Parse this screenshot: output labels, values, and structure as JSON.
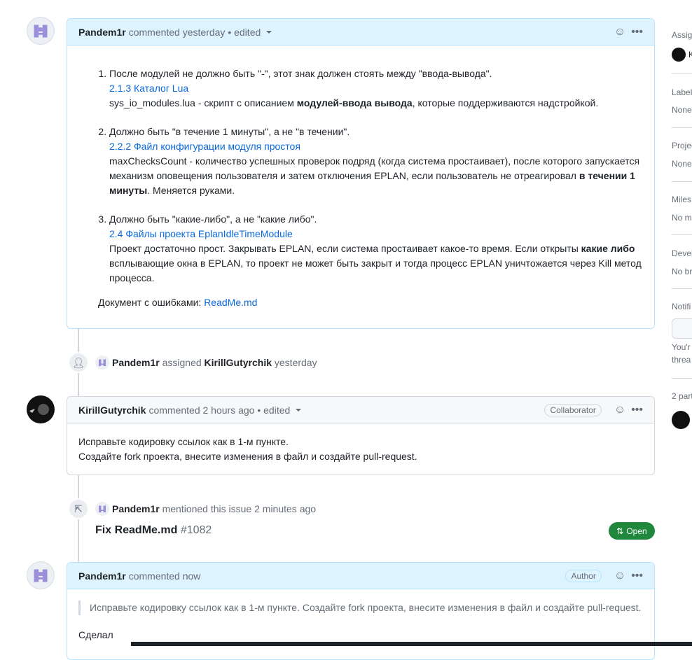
{
  "comments": [
    {
      "author": "Pandem1r",
      "action": "commented yesterday",
      "edited": "• edited",
      "items": [
        {
          "text": "После модулей не должно быть \"-\", этот знак должен стоять между \"ввода-вывода\".",
          "link": "2.1.3 Каталог Lua",
          "desc_pre": "sys_io_modules.lua - скрипт с описанием ",
          "desc_bold": "модулей-ввода вывода",
          "desc_post": ", которые поддерживаются надстройкой."
        },
        {
          "text": "Должно быть \"в течение 1 минуты\", а не \"в течении\".",
          "link": "2.2.2 Файл конфигурации модуля простоя",
          "desc_pre": "maxChecksCount - количество успешных проверок подряд (когда система простаивает), после которого запускается механизм оповещения пользователя и затем отключения EPLAN, если пользователь не отреагировал ",
          "desc_bold": "в течении 1 минуты",
          "desc_post": ". Меняется руками."
        },
        {
          "text": "Должно быть \"какие-либо\", а не \"какие либо\".",
          "link": "2.4 Файлы проекта EplanIdleTimeModule",
          "desc_pre": "Проект достаточно прост. Закрывать EPLAN, если система простаивает какое-то время. Если открыты ",
          "desc_bold": "какие либо",
          "desc_post": " всплывающие окна в EPLAN, то проект не может быть закрыт и тогда процесс EPLAN уничтожается через Kill метод процесса."
        }
      ],
      "doc_label": "Документ с ошибками: ",
      "doc_link": "ReadMe.md"
    },
    {
      "author": "KirillGutyrchik",
      "action": "commented 2 hours ago",
      "edited": "• edited",
      "badge": "Collaborator",
      "lines": [
        "Исправьте кодировку ссылок как в 1-м пункте.",
        "Создайте fork проекта, внесите изменения в файл и создайте pull-request."
      ]
    },
    {
      "author": "Pandem1r",
      "action": "commented now",
      "badge": "Author",
      "quote": "Исправьте кодировку ссылок как в 1-м пункте. Создайте fork проекта, внесите изменения в файл и создайте pull-request.",
      "text": "Сделал"
    }
  ],
  "events": {
    "assigned": {
      "actor": "Pandem1r",
      "verb": "assigned",
      "target": "KirillGutyrchik",
      "time": "yesterday"
    },
    "mentioned": {
      "actor": "Pandem1r",
      "text": "mentioned this issue 2 minutes ago",
      "pr_title": "Fix ReadMe.md",
      "pr_number": "#1082",
      "pr_state": "Open"
    }
  },
  "sidebar": {
    "assignees": "Assig",
    "assignee_name": "K",
    "labels": "Label",
    "labels_value": "None",
    "projects": "Projec",
    "projects_value": "None",
    "milestone": "Miles",
    "milestone_value": "No m",
    "development": "Devel",
    "development_value": "No br",
    "notifications": "Notifi",
    "notif_text1": "You'r",
    "notif_text2": "threa",
    "participants": "2 part"
  },
  "colors": {
    "accent": "#0969da",
    "open": "#1f883d",
    "author_header": "#ddf4ff"
  }
}
